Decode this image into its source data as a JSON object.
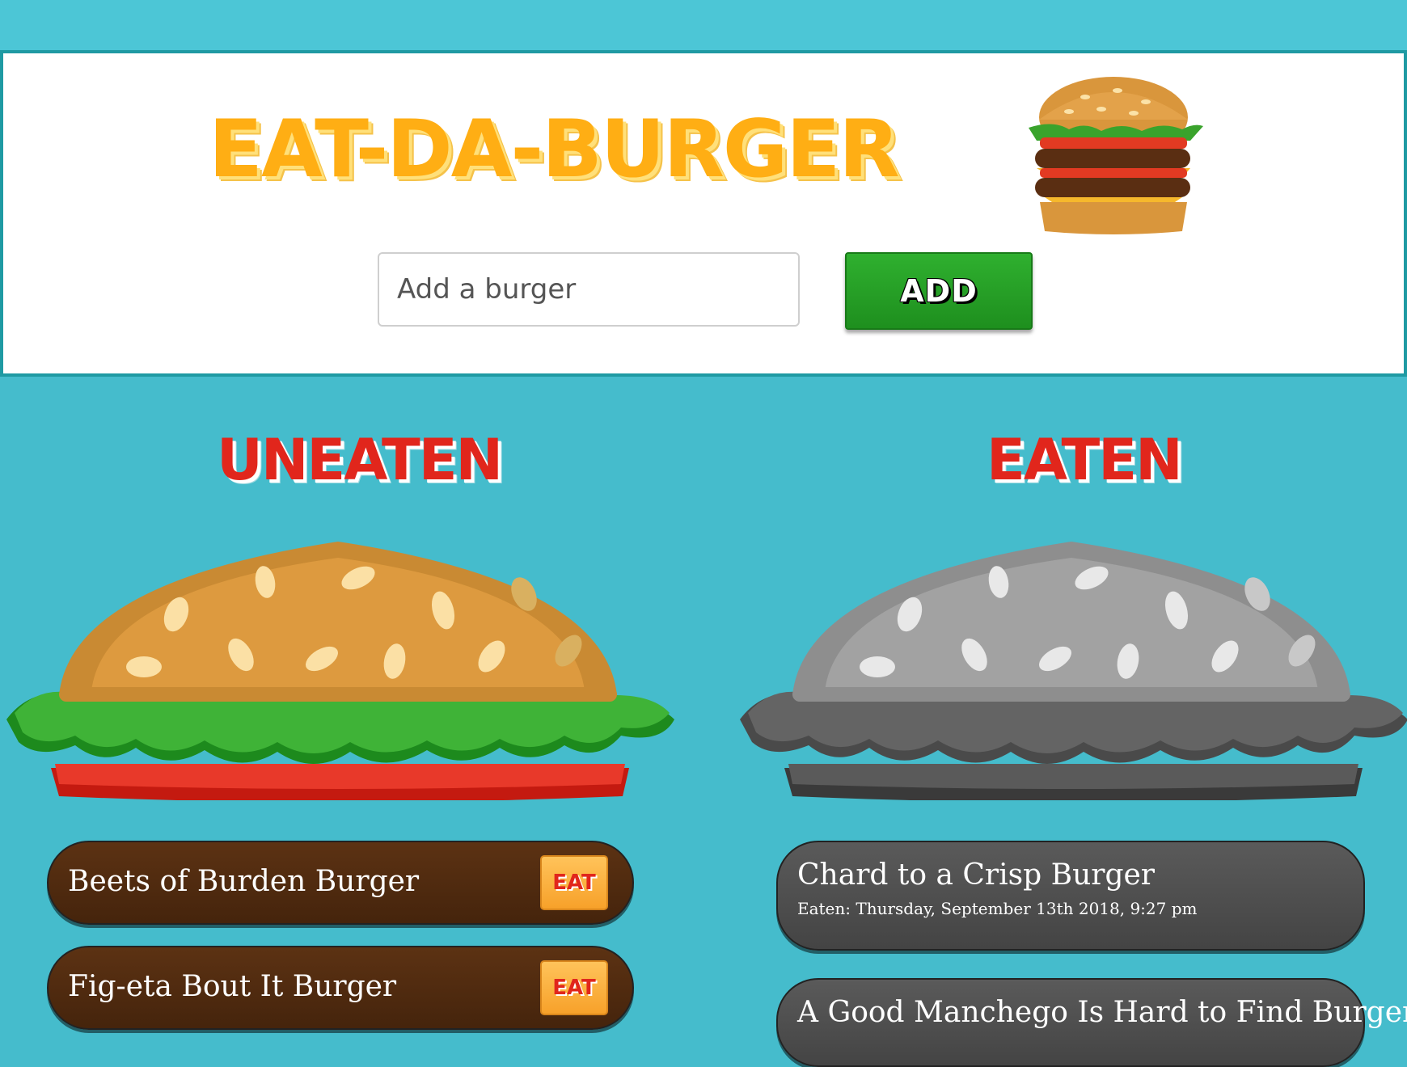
{
  "header": {
    "title": "EAT-DA-BURGER",
    "logo_icon": "burger-icon",
    "input_placeholder": "Add a burger",
    "add_label": "ADD"
  },
  "columns": {
    "uneaten_heading": "UNEATEN",
    "eaten_heading": "EATEN"
  },
  "uneaten": [
    {
      "name": "Beets of Burden Burger",
      "button": "EAT"
    },
    {
      "name": "Fig-eta Bout It Burger",
      "button": "EAT"
    }
  ],
  "eaten": [
    {
      "name": "Chard to a Crisp Burger",
      "date": "Eaten: Thursday, September 13th 2018, 9:27 pm"
    },
    {
      "name": "A Good Manchego Is Hard to Find Burger"
    }
  ],
  "colors": {
    "background": "#45bccc",
    "title": "#ffae14",
    "heading": "#e1261c",
    "add_button": "#2fb02f",
    "uneaten_row": "#5c3213",
    "eaten_row": "#4f4f4f"
  }
}
